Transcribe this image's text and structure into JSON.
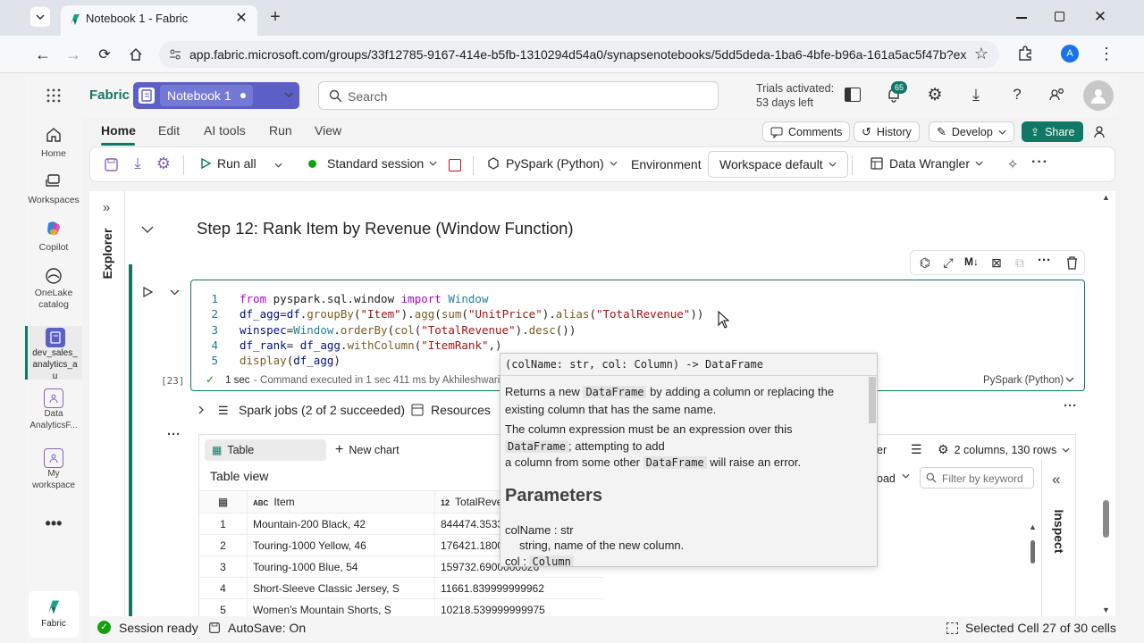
{
  "browser": {
    "tab_title": "Notebook 1 - Fabric",
    "url": "app.fabric.microsoft.com/groups/33f12785-9167-414e-b5fb-1310294d54a0/synapsenotebooks/5dd5deda-1ba6-4bfe-b96a-161a5ac5f47b?exper...",
    "profile_initial": "A"
  },
  "header": {
    "brand": "Fabric",
    "notebook_name": "Notebook 1",
    "search_placeholder": "Search",
    "trial_line1": "Trials activated:",
    "trial_line2": "53 days left",
    "notif_count": "65"
  },
  "leftrail": [
    {
      "label": "Home",
      "icon": "home-icon"
    },
    {
      "label": "Workspaces",
      "icon": "workspaces-icon"
    },
    {
      "label": "Copilot",
      "icon": "copilot-icon"
    },
    {
      "label": "OneLake catalog",
      "icon": "onelake-icon"
    },
    {
      "label": "dev_sales_analytics_au",
      "icon": "workspace-item-icon"
    },
    {
      "label": "Data AnalyticsF...",
      "icon": "data-analytics-icon"
    },
    {
      "label": "My workspace",
      "icon": "my-workspace-icon"
    },
    {
      "label": "Fabric",
      "icon": "fabric-logo-icon"
    }
  ],
  "menu_tabs": [
    "Home",
    "Edit",
    "AI tools",
    "Run",
    "View"
  ],
  "right_actions": {
    "comments": "Comments",
    "history": "History",
    "develop": "Develop",
    "share": "Share"
  },
  "toolbar": {
    "run_all": "Run all",
    "session": "Standard session",
    "language": "PySpark (Python)",
    "environment_label": "Environment",
    "environment_value": "Workspace default",
    "data_wrangler": "Data Wrangler"
  },
  "explorer_label": "Explorer",
  "cell": {
    "heading": "Step 12: Rank Item by Revenue (Window Function)",
    "exec_count": "[23]",
    "status_time": "1 sec",
    "status_text": "- Command executed in 1 sec 411 ms by Akhileshwari I",
    "language_badge": "PySpark (Python)",
    "code_lines": [
      [
        {
          "t": "from ",
          "c": "kw"
        },
        {
          "t": "pyspark.sql.window ",
          "c": ""
        },
        {
          "t": "import ",
          "c": "kw"
        },
        {
          "t": "Window",
          "c": "cls"
        }
      ],
      [
        {
          "t": "df_agg",
          "c": "var"
        },
        {
          "t": "=",
          "c": ""
        },
        {
          "t": "df",
          "c": "var"
        },
        {
          "t": ".",
          "c": ""
        },
        {
          "t": "groupBy",
          "c": "fn"
        },
        {
          "t": "(",
          "c": ""
        },
        {
          "t": "\"Item\"",
          "c": "st"
        },
        {
          "t": ").",
          "c": ""
        },
        {
          "t": "agg",
          "c": "fn"
        },
        {
          "t": "(",
          "c": ""
        },
        {
          "t": "sum",
          "c": "fn"
        },
        {
          "t": "(",
          "c": ""
        },
        {
          "t": "\"UnitPrice\"",
          "c": "st"
        },
        {
          "t": ").",
          "c": ""
        },
        {
          "t": "alias",
          "c": "fn"
        },
        {
          "t": "(",
          "c": ""
        },
        {
          "t": "\"TotalRevenue\"",
          "c": "st"
        },
        {
          "t": "))",
          "c": ""
        }
      ],
      [
        {
          "t": "winspec",
          "c": "var"
        },
        {
          "t": "=",
          "c": ""
        },
        {
          "t": "Window",
          "c": "cls"
        },
        {
          "t": ".",
          "c": ""
        },
        {
          "t": "orderBy",
          "c": "fn"
        },
        {
          "t": "(",
          "c": ""
        },
        {
          "t": "col",
          "c": "fn"
        },
        {
          "t": "(",
          "c": ""
        },
        {
          "t": "\"TotalRevenue\"",
          "c": "st"
        },
        {
          "t": ").",
          "c": ""
        },
        {
          "t": "desc",
          "c": "fn"
        },
        {
          "t": "())",
          "c": ""
        }
      ],
      [
        {
          "t": "df_rank",
          "c": "var"
        },
        {
          "t": "= ",
          "c": ""
        },
        {
          "t": "df_agg",
          "c": "var"
        },
        {
          "t": ".",
          "c": ""
        },
        {
          "t": "withColumn",
          "c": "fn"
        },
        {
          "t": "(",
          "c": ""
        },
        {
          "t": "\"ItemRank\"",
          "c": "st"
        },
        {
          "t": ",)",
          "c": ""
        }
      ],
      [
        {
          "t": "display",
          "c": "fn"
        },
        {
          "t": "(",
          "c": ""
        },
        {
          "t": "df_agg",
          "c": "var"
        },
        {
          "t": ")",
          "c": ""
        }
      ]
    ]
  },
  "output": {
    "spark_jobs": "Spark jobs (2 of 2 succeeded)",
    "resources": "Resources",
    "view_table": "Table",
    "new_chart": "New chart",
    "table_view_title": "Table view",
    "columns_rows": "2 columns, 130 rows",
    "filter_placeholder": "Filter by keyword",
    "download_partial": "oad",
    "er_partial": "er",
    "inspect": "Inspect",
    "columns": [
      "Item",
      "TotalReve"
    ],
    "rows": [
      [
        "1",
        "Mountain-200 Black, 42",
        "844474.3533"
      ],
      [
        "2",
        "Touring-1000 Yellow, 46",
        "176421.1800"
      ],
      [
        "3",
        "Touring-1000 Blue, 54",
        "159732.6900000026"
      ],
      [
        "4",
        "Short-Sleeve Classic Jersey, S",
        "11661.839999999962"
      ],
      [
        "5",
        "Women's Mountain Shorts, S",
        "10218.539999999975"
      ]
    ]
  },
  "tooltip": {
    "signature": "(colName: str, col: Column) -> DataFrame",
    "desc1_pre": "Returns a new ",
    "desc1_code": "DataFrame",
    "desc1_post": " by adding a column or replacing the existing column that has the same name.",
    "desc2_pre": "The column expression must be an expression over this",
    "desc2_code": "DataFrame",
    "desc2_mid": "; attempting to add",
    "desc2_line3_pre": "a column from some other ",
    "desc2_code2": "DataFrame",
    "desc2_post": " will raise an error.",
    "params_heading": "Parameters",
    "param1_name": "colName : str",
    "param1_desc": "string, name of the new column.",
    "param2_name": "col : ",
    "param2_code": "Column"
  },
  "statusbar": {
    "session": "Session ready",
    "autosave": "AutoSave: On",
    "selected": "Selected Cell 27 of 30 cells"
  },
  "colors": {
    "accent": "#117865",
    "notebook_pill": "#5b5fc7",
    "share": "#117865",
    "session_dot": "#13a10e"
  }
}
